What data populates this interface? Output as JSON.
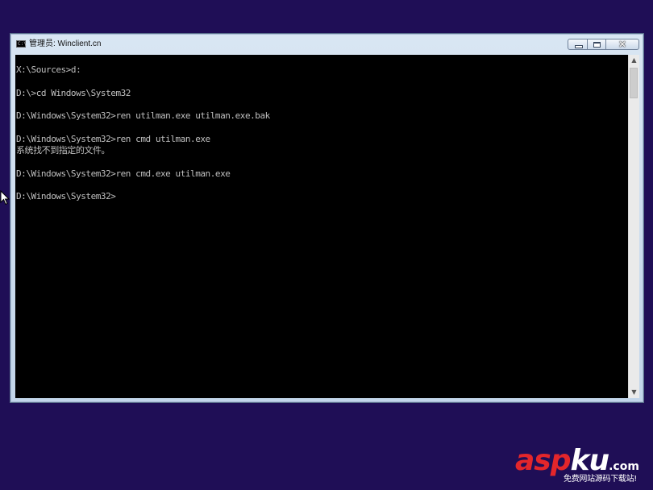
{
  "window": {
    "title": "管理员: Winclient.cn",
    "icon": "console-icon",
    "icon_text": "C:\\",
    "buttons": {
      "minimize": "minimize-icon",
      "maximize": "maximize-icon",
      "close": "close-icon",
      "close_glyph": "✕"
    }
  },
  "console": {
    "lines": [
      "X:\\Sources>d:",
      "",
      "D:\\>cd Windows\\System32",
      "",
      "D:\\Windows\\System32>ren utilman.exe utilman.exe.bak",
      "",
      "D:\\Windows\\System32>ren cmd utilman.exe",
      "系统找不到指定的文件。",
      "",
      "D:\\Windows\\System32>ren cmd.exe utilman.exe",
      "",
      "D:\\Windows\\System32>"
    ],
    "text_color": "#c0c0c0",
    "background": "#000000"
  },
  "scrollbar": {
    "up": "▲",
    "down": "▼"
  },
  "desktop": {
    "background": "#1f0e56"
  },
  "watermark": {
    "brand_red": "asp",
    "brand_white": "ku",
    "domain_suffix": ".com",
    "tagline": "免费网站源码下载站!",
    "accent": "#e3262b"
  }
}
